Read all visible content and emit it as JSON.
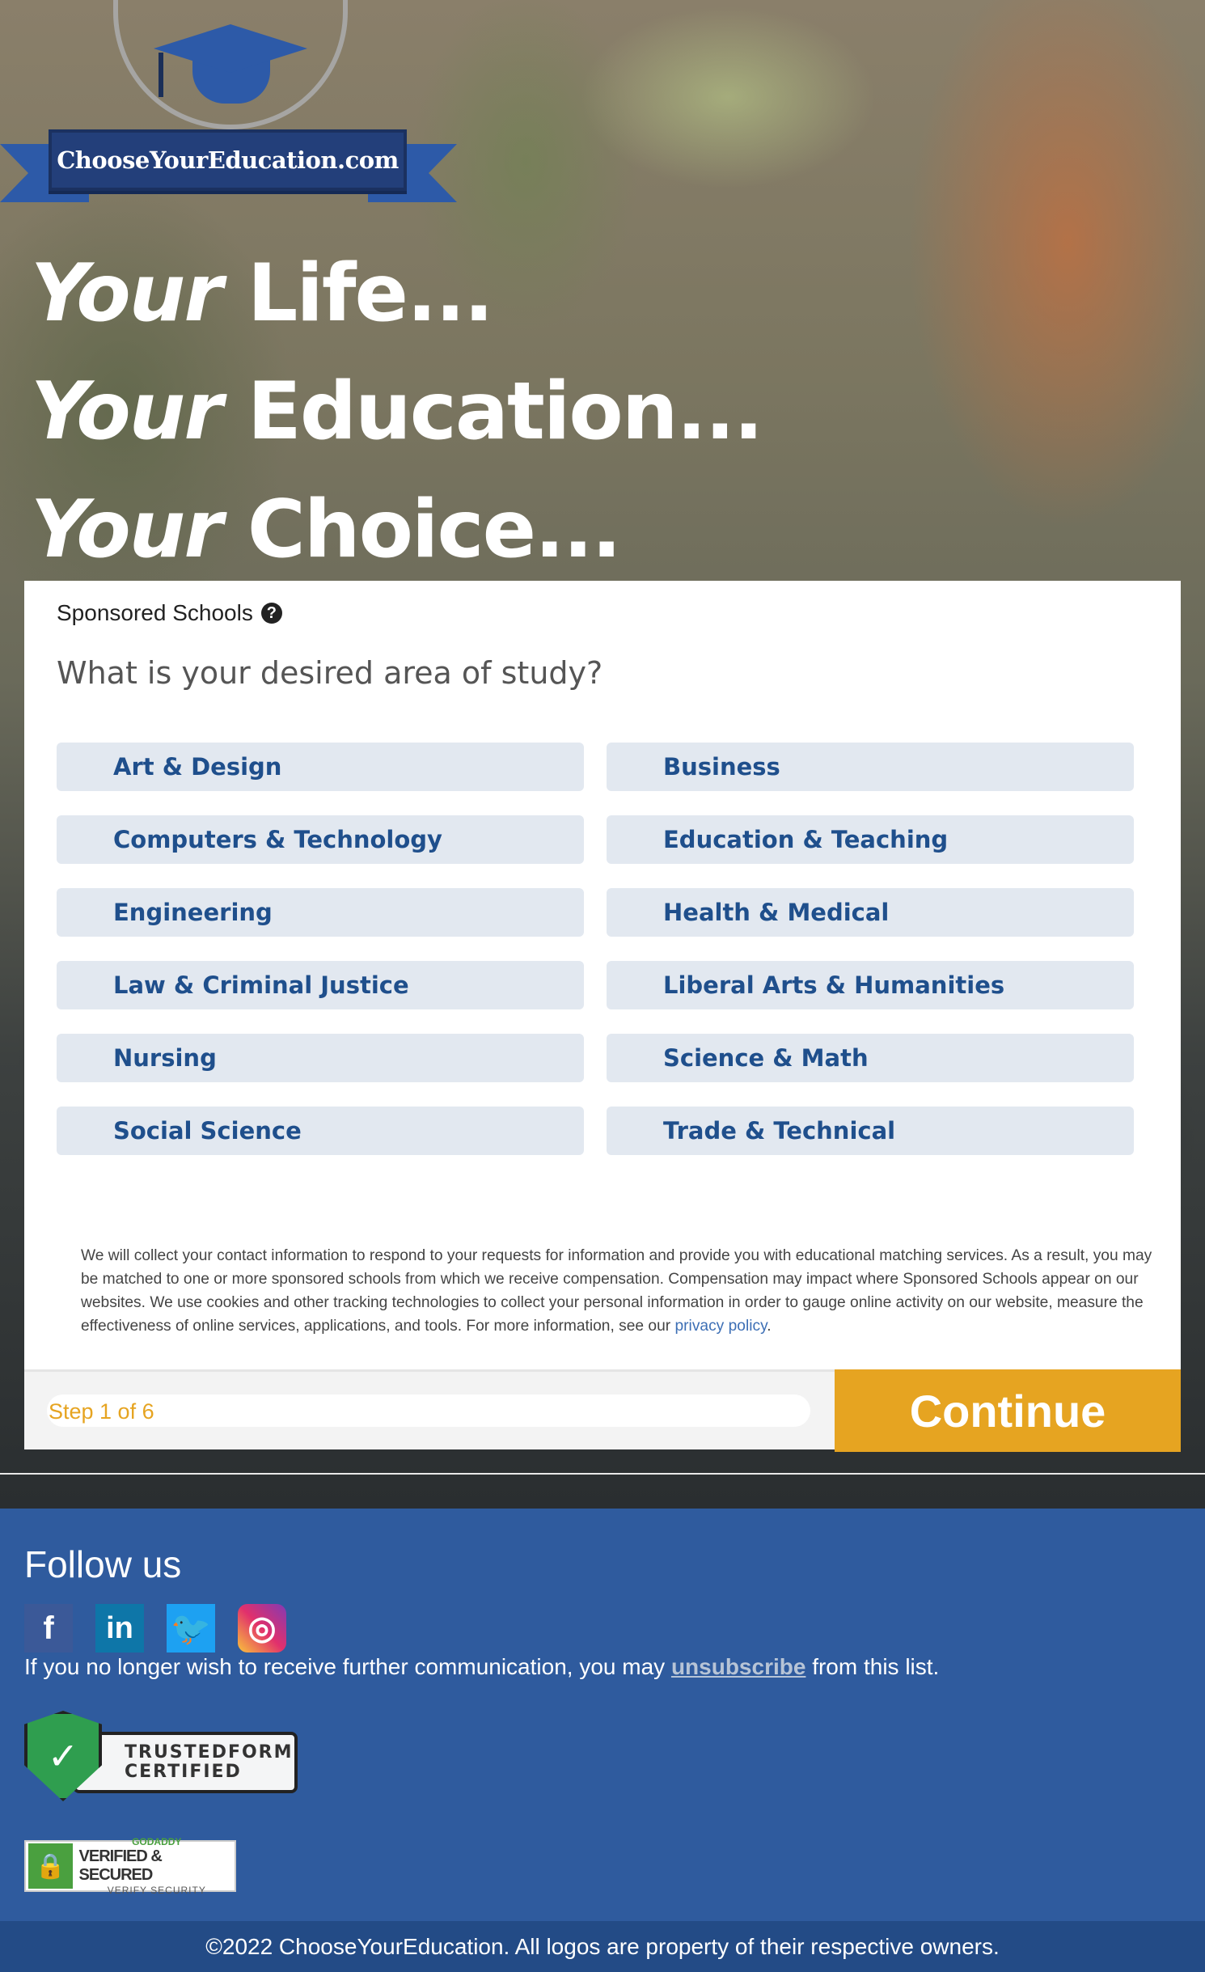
{
  "logo": {
    "text": "ChooseYourEducation.com"
  },
  "headline": {
    "lines": [
      {
        "italic": "Your",
        "rest": " Life..."
      },
      {
        "italic": "Your",
        "rest": " Education..."
      },
      {
        "italic": "Your",
        "rest": " Choice..."
      }
    ]
  },
  "form": {
    "sponsored_label": "Sponsored Schools",
    "help_icon": "question-circle-icon",
    "question": "What is your desired area of study?",
    "options": [
      "Art & Design",
      "Business",
      "Computers & Technology",
      "Education & Teaching",
      "Engineering",
      "Health & Medical",
      "Law & Criminal Justice",
      "Liberal Arts & Humanities",
      "Nursing",
      "Science & Math",
      "Social Science",
      "Trade & Technical"
    ],
    "disclaimer": "We will collect your contact information to respond to your requests for information and provide you with educational matching services. As a result, you may be matched to one or more sponsored schools from which we receive compensation. Compensation may impact where Sponsored Schools appear on our websites. We use cookies and other tracking technologies to collect your personal information in order to gauge online activity on our website, measure the effectiveness of online services, applications, and tools. For more information, see our",
    "privacy_link": "privacy policy",
    "disclaimer_end": ".",
    "step_label": "Step 1 of 6",
    "continue_label": "Continue"
  },
  "footer": {
    "follow_label": "Follow us",
    "socials": [
      {
        "name": "facebook-icon",
        "glyph": "f"
      },
      {
        "name": "linkedin-icon",
        "glyph": "in"
      },
      {
        "name": "twitter-icon",
        "glyph": "🐦"
      },
      {
        "name": "instagram-icon",
        "glyph": "◎"
      }
    ],
    "unsub_before": "If you no longer wish to receive further communication, you may ",
    "unsub_link": "unsubscribe",
    "unsub_after": " from this list.",
    "trusted_line1": "TRUSTEDFORM",
    "trusted_line2": "CERTIFIED",
    "godaddy_line1": "GODADDY",
    "godaddy_line2": "VERIFIED & SECURED",
    "godaddy_line3": "VERIFY SECURITY",
    "copyright": "©2022 ChooseYourEducation. All logos are property of their respective owners."
  },
  "colors": {
    "accent": "#e6a421",
    "option_text": "#1f4f8c",
    "option_bg": "#e2e8f0",
    "footer_bg": "#2f5b9e"
  }
}
